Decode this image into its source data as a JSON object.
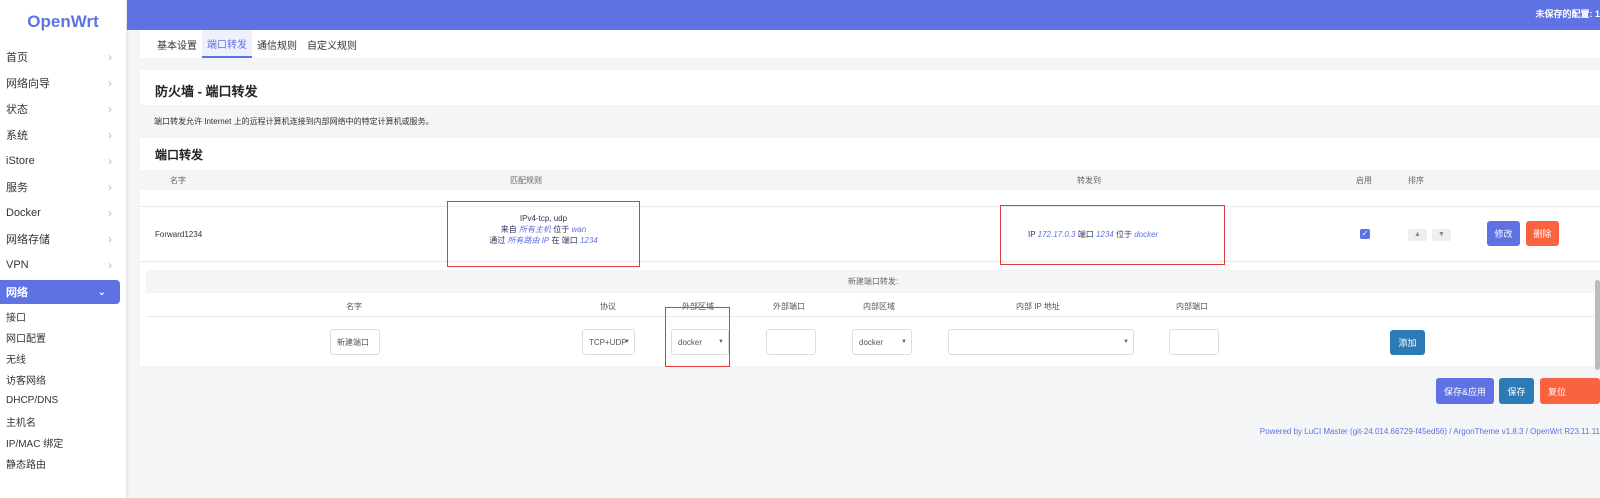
{
  "app": {
    "logo": "OpenWrt",
    "unsaved_notice": "未保存的配置: 1"
  },
  "sidebar": {
    "items": [
      {
        "label": "首页"
      },
      {
        "label": "网络向导"
      },
      {
        "label": "状态"
      },
      {
        "label": "系统"
      },
      {
        "label": "iStore"
      },
      {
        "label": "服务"
      },
      {
        "label": "Docker"
      },
      {
        "label": "网络存储"
      },
      {
        "label": "VPN"
      },
      {
        "label": "网络"
      }
    ],
    "subitems": [
      {
        "label": "接口"
      },
      {
        "label": "网口配置"
      },
      {
        "label": "无线"
      },
      {
        "label": "访客网络"
      },
      {
        "label": "DHCP/DNS"
      },
      {
        "label": "主机名"
      },
      {
        "label": "IP/MAC 绑定"
      },
      {
        "label": "静态路由"
      }
    ]
  },
  "tabs": [
    {
      "label": "基本设置"
    },
    {
      "label": "端口转发"
    },
    {
      "label": "通信规则"
    },
    {
      "label": "自定义规则"
    }
  ],
  "page": {
    "title": "防火墙 - 端口转发",
    "description": "端口转发允许 Internet 上的远程计算机连接到内部网络中的特定计算机或服务。",
    "section_title": "端口转发"
  },
  "table": {
    "headers": {
      "name": "名字",
      "match": "匹配规则",
      "forward": "转发到",
      "enable": "启用",
      "sort": "排序"
    },
    "rows": [
      {
        "name": "Forward1234",
        "match_line1": "IPv4-tcp, udp",
        "from_prefix": "来自",
        "from_host": "所有主机",
        "from_mid": "位于",
        "from_zone": "wan",
        "via_prefix": "通过",
        "via_host": "所有路由 IP",
        "via_mid": "在 端口",
        "via_port": "1234",
        "fwd_ip_prefix": "IP",
        "fwd_ip": "172.17.0.3",
        "fwd_port_prefix": "端口",
        "fwd_port": "1234",
        "fwd_zone_prefix": "位于",
        "fwd_zone": "docker",
        "enabled": true,
        "edit_label": "修改",
        "delete_label": "删除"
      }
    ]
  },
  "new_rule": {
    "title": "新建端口转发:",
    "headers": {
      "name": "名字",
      "protocol": "协议",
      "ext_zone": "外部区域",
      "ext_port": "外部端口",
      "int_zone": "内部区域",
      "int_ip": "内部 IP 地址",
      "int_port": "内部端口"
    },
    "name_value": "新建端口",
    "protocol_value": "TCP+UDP",
    "ext_zone_value": "docker",
    "ext_port_value": "",
    "int_zone_value": "docker",
    "int_ip_value": "",
    "int_port_value": "",
    "add_label": "添加"
  },
  "actions": {
    "save_apply": "保存&应用",
    "save": "保存",
    "reset": "复位"
  },
  "footer": "Powered by LuCI Master (git-24.014.66729-f45ed56) / ArgonTheme v1.8.3 / OpenWrt R23.11.11",
  "colors": {
    "accent": "#5e72e4",
    "danger": "#fb6340",
    "save": "#2d7bb6"
  }
}
